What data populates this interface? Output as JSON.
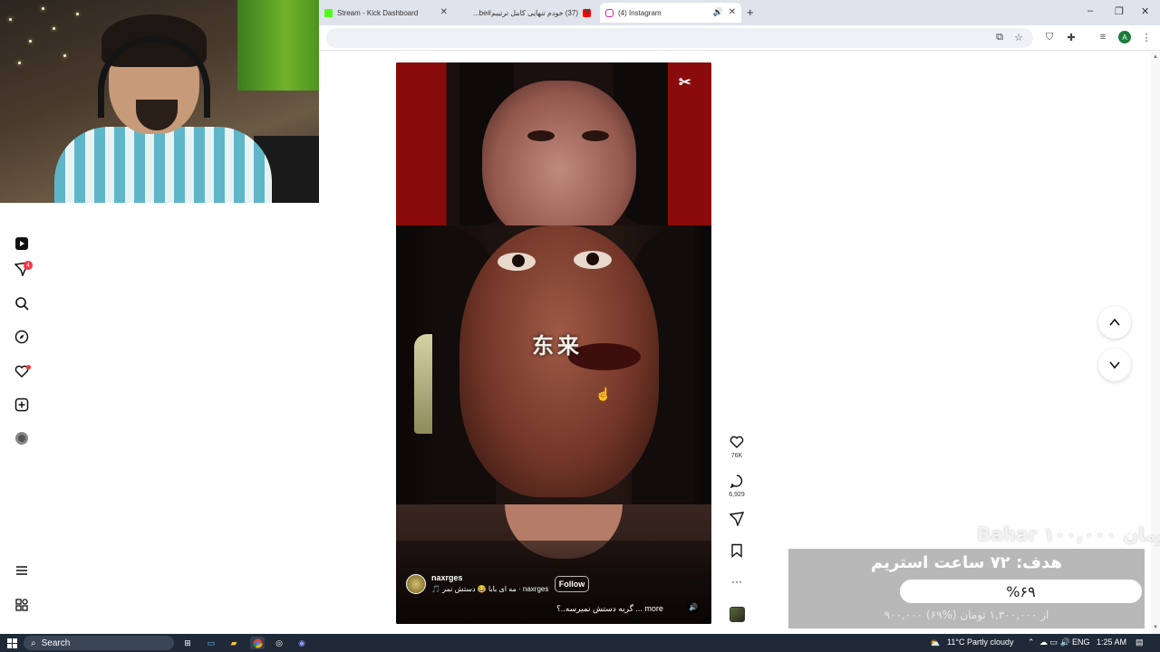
{
  "browser": {
    "tabs": [
      {
        "label": "Stream - Kick Dashboard",
        "icon": "kick-icon",
        "color": "#53fc18"
      },
      {
        "label": "(37) خودم تنهایی کامل ترتیبم#be...",
        "icon": "youtube-icon",
        "color": "#ff0000"
      },
      {
        "label": "(4) Instagram",
        "icon": "instagram-icon",
        "color": "#d6249f"
      }
    ],
    "new_tab_icon": "plus-icon",
    "profile_initial": "A"
  },
  "instagram": {
    "nav": {
      "messages_badge": "4"
    },
    "reel": {
      "overlay_text": "东来",
      "author": "naxrges",
      "audio": "naxrges · مه ای بابا 😂 دستش نمر 🎵",
      "follow_label": "Follow",
      "caption": "گربه دستش نمیرسه..؟ ... more",
      "likes": "76K",
      "comments": "6,929"
    }
  },
  "donation": {
    "scroll_name": "Bahar ۱۰۰,۰۰۰ تومان",
    "goal_title": "هدف: ۷۲ ساعت استریم",
    "goal_percent_label": "%۶۹",
    "goal_fraction": 0.69,
    "goal_amount": "۹۰۰,۰۰۰ از ۱,۳۰۰,۰۰۰ تومان (%۶۹)"
  },
  "taskbar": {
    "search_label": "Search",
    "weather": "11°C  Partly cloudy",
    "language": "ENG",
    "time": "1:25 AM"
  }
}
